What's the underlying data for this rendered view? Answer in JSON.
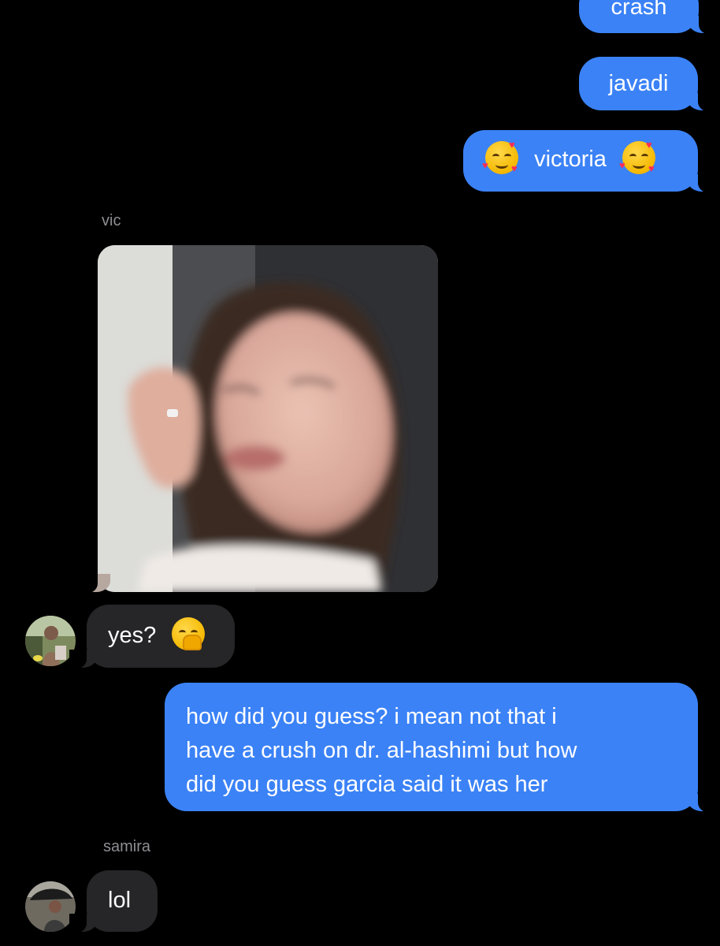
{
  "messages": {
    "m1": "crash",
    "m2": "javadi",
    "m3": "victoria",
    "m4": "yes?",
    "m5_lines": [
      "how did you guess? i mean not that i",
      "have a crush on dr. al-hashimi but how",
      "did you guess garcia said it was her"
    ],
    "m6": "lol"
  },
  "senders": {
    "vic": "vic",
    "samira": "samira"
  },
  "emojis": {
    "victoria": "smiling-face-with-hearts",
    "yes": "hand-over-mouth-face"
  },
  "colors": {
    "outgoing_bubble": "#3b82f6",
    "incoming_bubble": "#262628",
    "background": "#000000",
    "sender_label": "#8e8e93"
  }
}
